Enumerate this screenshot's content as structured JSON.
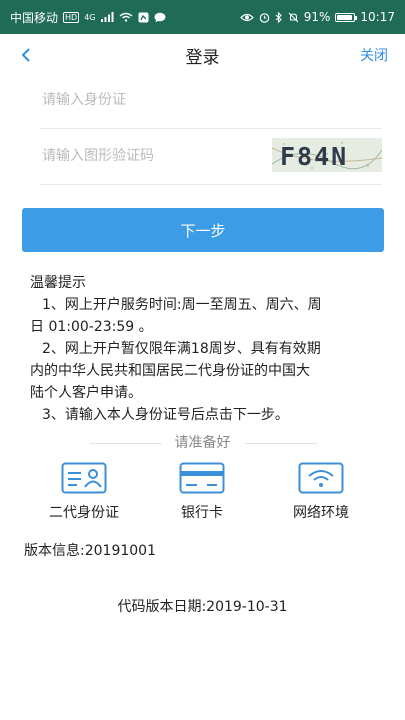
{
  "status_bar": {
    "carrier": "中国移动",
    "hd": "HD",
    "network": "4G",
    "battery": "91%",
    "time": "10:17",
    "bg_color": "#1f6b55"
  },
  "nav": {
    "title": "登录",
    "close_label": "关闭",
    "back_icon": "chevron-left-icon"
  },
  "form": {
    "id_placeholder": "请输入身份证",
    "captcha_placeholder": "请输入图形验证码",
    "captcha_text": "F84N"
  },
  "next_button": {
    "label": "下一步",
    "color": "#3d9ce6"
  },
  "tips": {
    "title": "温馨提示",
    "line1a": "1、网上开户服务时间:周一至周五、周六、周",
    "line1b": "日 01:00-23:59 。",
    "line2a": "2、网上开户暂仅限年满18周岁、具有有效期",
    "line2b": "内的中华人民共和国居民二代身份证的中国大",
    "line2c": "陆个人客户申请。",
    "line3": "3、请输入本人身份证号后点击下一步。"
  },
  "prepare": {
    "title": "请准备好",
    "items": [
      {
        "label": "二代身份证",
        "icon": "id-card-icon"
      },
      {
        "label": "银行卡",
        "icon": "bank-card-icon"
      },
      {
        "label": "网络环境",
        "icon": "wifi-icon"
      }
    ]
  },
  "version_info": "版本信息:20191001",
  "code_version": "代码版本日期:2019-10-31"
}
